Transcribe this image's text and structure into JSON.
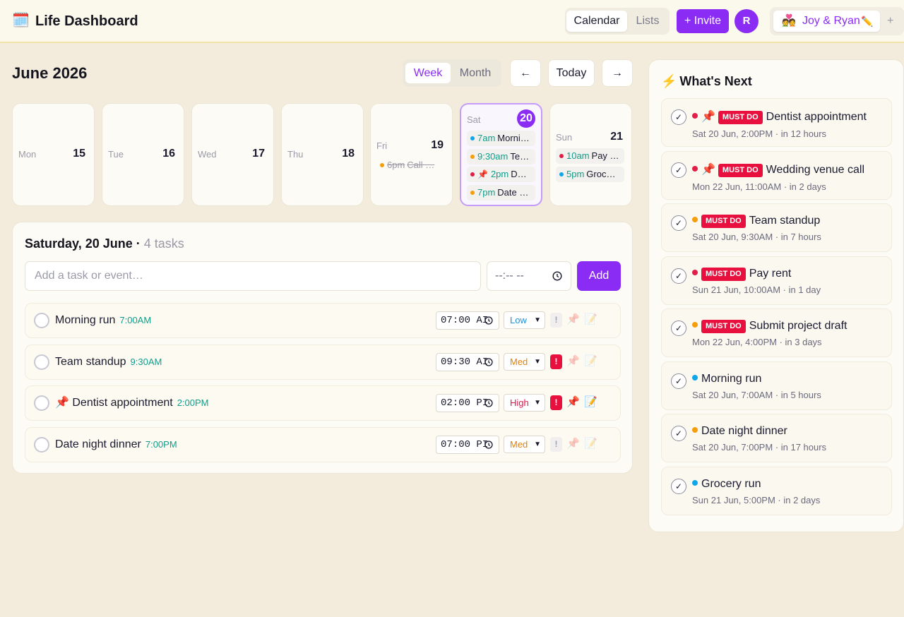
{
  "header": {
    "app_icon": "calendar-emoji-icon",
    "app_icon_glyph": "🗓️",
    "app_title": "Life Dashboard",
    "view_tabs": [
      "Calendar",
      "Lists"
    ],
    "invite_label": "+ Invite",
    "avatar_initial": "R",
    "space_emoji": "💑",
    "space_name": "Joy & Ryan",
    "space_edit_glyph": "✏️",
    "space_add": "+"
  },
  "calendar": {
    "month_title": "June 2026",
    "range_tabs": [
      "Week",
      "Month"
    ],
    "active_range": "Week",
    "prev_label": "←",
    "today_label": "Today",
    "next_label": "→",
    "days": [
      {
        "name": "Mon",
        "num": "15",
        "events": []
      },
      {
        "name": "Tue",
        "num": "16",
        "events": []
      },
      {
        "name": "Wed",
        "num": "17",
        "events": []
      },
      {
        "name": "Thu",
        "num": "18",
        "events": []
      },
      {
        "name": "Fri",
        "num": "19",
        "events": [
          {
            "time": "6pm",
            "title": "Call …",
            "dot": "#f59e0b",
            "done": true
          }
        ]
      },
      {
        "name": "Sat",
        "num": "20",
        "selected": true,
        "events": [
          {
            "time": "7am",
            "title": "Morni…",
            "dot": "#0ea5e9"
          },
          {
            "time": "9:30am",
            "title": "Te…",
            "dot": "#f59e0b"
          },
          {
            "time": "2pm",
            "title": "D…",
            "dot": "#e11d48",
            "pin": "📌"
          },
          {
            "time": "7pm",
            "title": "Date …",
            "dot": "#f59e0b"
          }
        ]
      },
      {
        "name": "Sun",
        "num": "21",
        "events": [
          {
            "time": "10am",
            "title": "Pay …",
            "dot": "#e11d48"
          },
          {
            "time": "5pm",
            "title": "Groc…",
            "dot": "#0ea5e9"
          }
        ]
      }
    ]
  },
  "tasks": {
    "day_title": "Saturday, 20 June",
    "separator": " · ",
    "count": "4 tasks",
    "input_placeholder": "Add a task or event…",
    "time_placeholder": "--:-- --",
    "add_label": "Add",
    "items": [
      {
        "pin": "",
        "name": "Morning run",
        "time_label": "7:00AM",
        "time_value": "07:00 AI",
        "priority": "Low",
        "priority_class": "prio-low",
        "flag": "!",
        "flag_on": false,
        "pinned": false,
        "note_on": false
      },
      {
        "pin": "",
        "name": "Team standup",
        "time_label": "9:30AM",
        "time_value": "09:30 AI",
        "priority": "Med",
        "priority_class": "prio-med",
        "flag": "!",
        "flag_on": true,
        "pinned": false,
        "note_on": false
      },
      {
        "pin": "📌 ",
        "name": "Dentist appointment",
        "time_label": "2:00PM",
        "time_value": "02:00 PI",
        "priority": "High",
        "priority_class": "prio-high",
        "flag": "!",
        "flag_on": true,
        "pinned": true,
        "note_on": true
      },
      {
        "pin": "",
        "name": "Date night dinner",
        "time_label": "7:00PM",
        "time_value": "07:00 PI",
        "priority": "Med",
        "priority_class": "prio-med",
        "flag": "!",
        "flag_on": false,
        "pinned": false,
        "note_on": false
      }
    ]
  },
  "whats_next": {
    "bolt": "⚡",
    "title": "What's Next",
    "must_label": "MUST DO",
    "items": [
      {
        "dot": "#e11d48",
        "pin": "📌",
        "must": true,
        "title": "Dentist appointment",
        "sub": "Sat 20 Jun, 2:00PM · in 12 hours"
      },
      {
        "dot": "#e11d48",
        "pin": "📌",
        "must": true,
        "title": "Wedding venue call",
        "sub": "Mon 22 Jun, 11:00AM · in 2 days"
      },
      {
        "dot": "#f59e0b",
        "pin": "",
        "must": true,
        "title": "Team standup",
        "sub": "Sat 20 Jun, 9:30AM · in 7 hours"
      },
      {
        "dot": "#e11d48",
        "pin": "",
        "must": true,
        "title": "Pay rent",
        "sub": "Sun 21 Jun, 10:00AM · in 1 day"
      },
      {
        "dot": "#f59e0b",
        "pin": "",
        "must": true,
        "title": "Submit project draft",
        "sub": "Mon 22 Jun, 4:00PM · in 3 days"
      },
      {
        "dot": "#0ea5e9",
        "pin": "",
        "must": false,
        "title": "Morning run",
        "sub": "Sat 20 Jun, 7:00AM · in 5 hours"
      },
      {
        "dot": "#f59e0b",
        "pin": "",
        "must": false,
        "title": "Date night dinner",
        "sub": "Sat 20 Jun, 7:00PM · in 17 hours"
      },
      {
        "dot": "#0ea5e9",
        "pin": "",
        "must": false,
        "title": "Grocery run",
        "sub": "Sun 21 Jun, 5:00PM · in 2 days"
      }
    ]
  },
  "colors": {
    "accent": "#8b2cf5",
    "must_do": "#e8103f",
    "time_text": "#0f9d8a"
  }
}
